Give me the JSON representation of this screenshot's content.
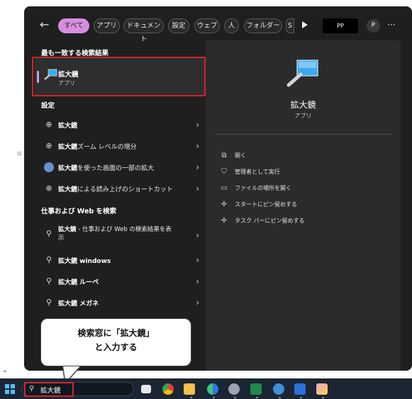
{
  "topbar": {
    "back_label": "←",
    "chips": [
      {
        "label": "すべて",
        "active": true
      },
      {
        "label": "アプリ",
        "active": false
      },
      {
        "label": "ドキュメント",
        "active": false
      },
      {
        "label": "設定",
        "active": false
      },
      {
        "label": "ウェブ",
        "active": false
      },
      {
        "label": "人",
        "active": false
      },
      {
        "label": "フォルダー",
        "active": false
      },
      {
        "label": "S",
        "active": false
      }
    ],
    "badge": "PP",
    "avatar": "P",
    "more": "···"
  },
  "best_match": {
    "section": "最も一致する検索結果",
    "name": "拡大鏡",
    "type": "アプリ"
  },
  "settings": {
    "section": "設定",
    "items": [
      {
        "bold": "拡大鏡",
        "rest": "",
        "icon": "zoom-in-icon"
      },
      {
        "bold": "拡大鏡",
        "rest": "ズーム レベルの増分",
        "icon": "zoom-in-icon"
      },
      {
        "bold": "拡大鏡",
        "rest": "を使った画面の一部の拡大",
        "icon": "magnifier-lens-icon"
      },
      {
        "bold": "拡大鏡",
        "rest": "による読み上げのショートカット",
        "icon": "zoom-in-icon"
      }
    ]
  },
  "web": {
    "section": "仕事および Web を検索",
    "items": [
      {
        "bold": "拡大鏡",
        "rest": " - 仕事および Web の検索結果を表示"
      },
      {
        "bold": "拡大鏡",
        "rest": " windows"
      },
      {
        "bold": "拡大鏡",
        "rest": " ルーペ"
      },
      {
        "bold": "拡大鏡",
        "rest": " メガネ"
      }
    ]
  },
  "preview": {
    "name": "拡大鏡",
    "type": "アプリ",
    "actions": [
      {
        "label": "開く",
        "icon": "open-icon"
      },
      {
        "label": "管理者として実行",
        "icon": "shield-icon"
      },
      {
        "label": "ファイルの場所を開く",
        "icon": "folder-icon"
      },
      {
        "label": "スタートにピン留めする",
        "icon": "pin-icon"
      },
      {
        "label": "タスク バーにピン留めする",
        "icon": "pin-icon"
      }
    ]
  },
  "callout": {
    "line1": "検索窓に「拡大鏡」",
    "line2": "と入力する"
  },
  "taskbar": {
    "search_text": "拡大鏡"
  },
  "colors": {
    "panel": "#1f1f1f",
    "preview": "#2b2b2b",
    "accent_chip": "#d88ee0",
    "highlight": "#d0252a",
    "taskbar": "#1c2533"
  }
}
